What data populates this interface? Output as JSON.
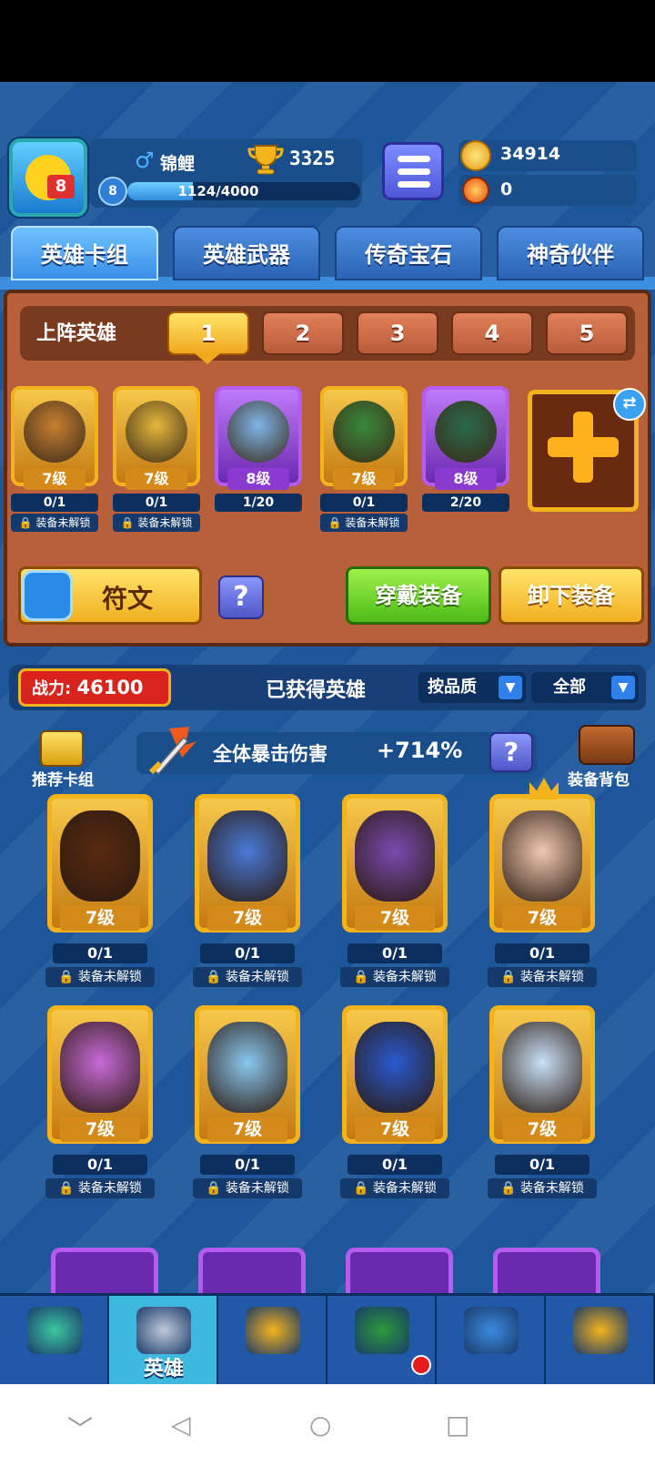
{
  "player": {
    "name": "锦鲤",
    "trophies": "3325",
    "level": "8",
    "xp_text": "1124/4000",
    "xp_fraction": 0.281
  },
  "currency": {
    "coins": "34914",
    "gems": "0"
  },
  "tabs": [
    {
      "label": "英雄卡组",
      "active": true
    },
    {
      "label": "英雄武器"
    },
    {
      "label": "传奇宝石"
    },
    {
      "label": "神奇伙伴"
    }
  ],
  "deck": {
    "label": "上阵英雄",
    "slots": [
      "1",
      "2",
      "3",
      "4",
      "5"
    ],
    "active_slot": 0,
    "cards": [
      {
        "level": "7级",
        "progress": "0/1",
        "lock": "装备未解锁",
        "rarity": "gold",
        "color": "#c88030"
      },
      {
        "level": "7级",
        "progress": "0/1",
        "lock": "装备未解锁",
        "rarity": "gold",
        "color": "#e6b83a"
      },
      {
        "level": "8级",
        "progress": "1/20",
        "rarity": "purple",
        "color": "#7fb6e8"
      },
      {
        "level": "7级",
        "progress": "0/1",
        "lock": "装备未解锁",
        "rarity": "gold",
        "color": "#3a8a3a"
      },
      {
        "level": "8级",
        "progress": "2/20",
        "rarity": "purple",
        "color": "#2a6a4a"
      }
    ],
    "rune_label": "符文",
    "help": "?",
    "equip_label": "穿戴装备",
    "unequip_label": "卸下装备"
  },
  "collection": {
    "power_label": "战力:",
    "power_value": "46100",
    "title": "已获得英雄",
    "sort_label": "按品质",
    "filter_label": "全部",
    "recommend_label": "推荐卡组",
    "crit_label": "全体暴击伤害",
    "crit_value": "+714%",
    "help": "?",
    "bag_label": "装备背包",
    "heroes": [
      {
        "level": "7级",
        "progress": "0/1",
        "lock": "装备未解锁",
        "color": "#5a2a10"
      },
      {
        "level": "7级",
        "progress": "0/1",
        "lock": "装备未解锁",
        "color": "#4a7ad8"
      },
      {
        "level": "7级",
        "progress": "0/1",
        "lock": "装备未解锁",
        "color": "#7a4ab0"
      },
      {
        "level": "7级",
        "progress": "0/1",
        "lock": "装备未解锁",
        "color": "#f0c8b0",
        "crown": true
      },
      {
        "level": "7级",
        "progress": "0/1",
        "lock": "装备未解锁",
        "color": "#c86ad8"
      },
      {
        "level": "7级",
        "progress": "0/1",
        "lock": "装备未解锁",
        "color": "#8ac8f0"
      },
      {
        "level": "7级",
        "progress": "0/1",
        "lock": "装备未解锁",
        "color": "#2a5ad0"
      },
      {
        "level": "7级",
        "progress": "0/1",
        "lock": "装备未解锁",
        "color": "#c8e0f8"
      }
    ]
  },
  "nav": [
    {
      "icon": "treasure-chest-icon"
    },
    {
      "icon": "knight-helmet-icon",
      "label": "英雄",
      "active": true
    },
    {
      "icon": "crossed-swords-icon"
    },
    {
      "icon": "crown-shield-icon",
      "badge": true
    },
    {
      "icon": "guild-banner-icon"
    },
    {
      "icon": "compass-icon"
    }
  ]
}
